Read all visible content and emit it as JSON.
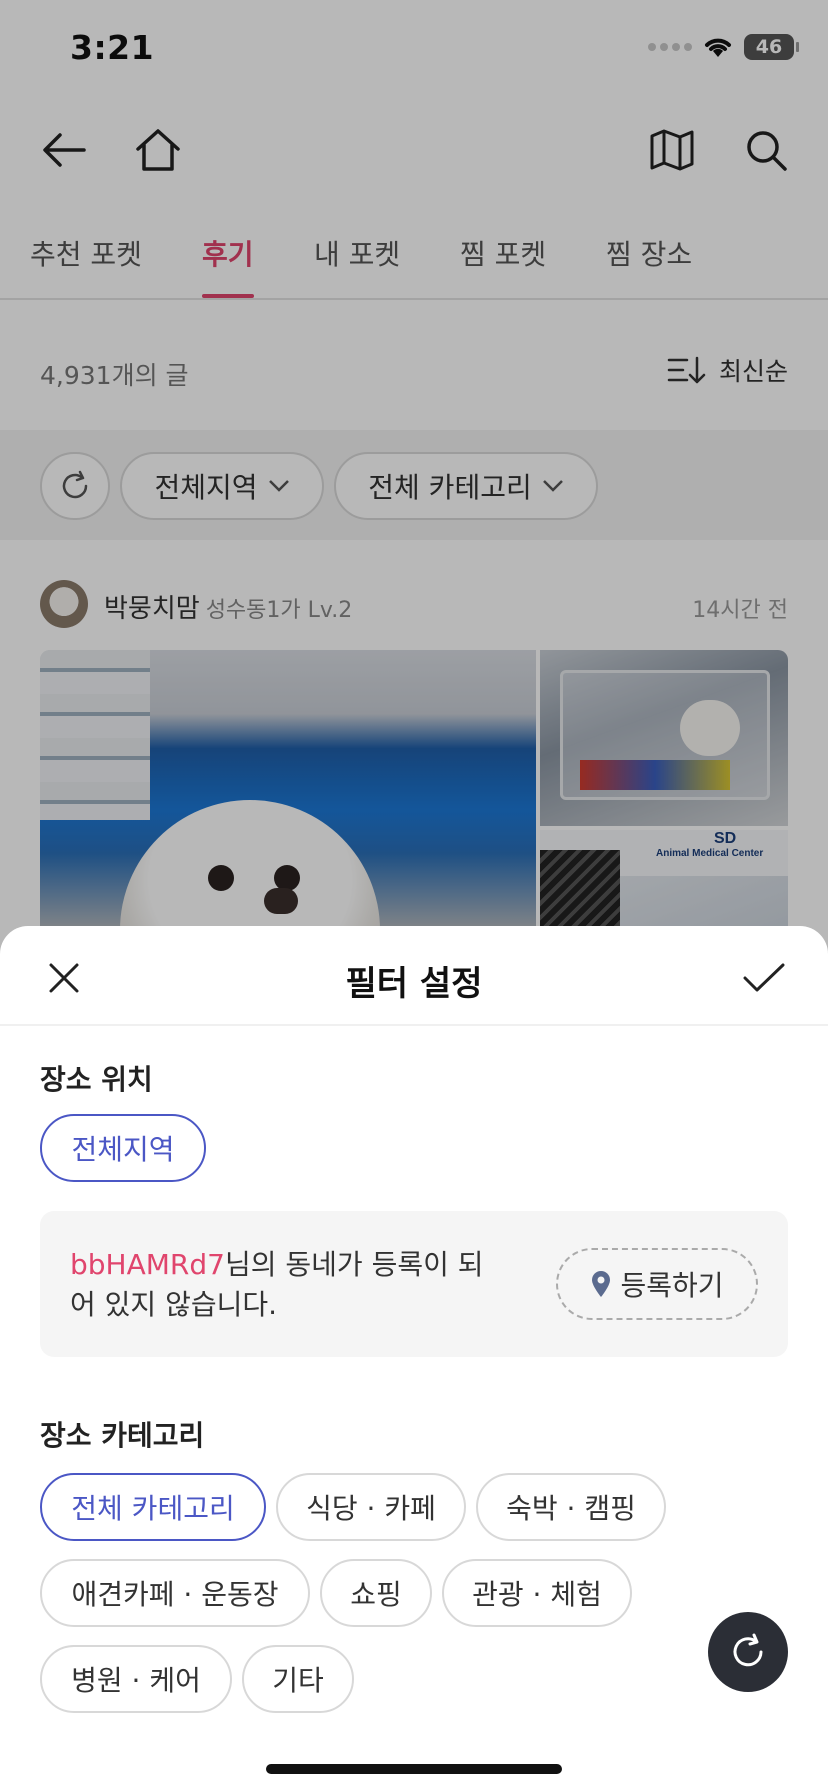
{
  "status_bar": {
    "time": "3:21",
    "battery": "46"
  },
  "nav": {
    "back_icon": "arrow-left-icon",
    "home_icon": "home-icon",
    "map_icon": "map-icon",
    "search_icon": "search-icon"
  },
  "tabs": [
    {
      "label": "추천 포켓",
      "active": false
    },
    {
      "label": "후기",
      "active": true
    },
    {
      "label": "내 포켓",
      "active": false
    },
    {
      "label": "찜 포켓",
      "active": false
    },
    {
      "label": "찜 장소",
      "active": false
    }
  ],
  "feed": {
    "post_count": "4,931개의 글",
    "sort_label": "최신순",
    "filter_chips": {
      "region": "전체지역",
      "category": "전체 카테고리"
    },
    "post": {
      "author": "박뭉치맘",
      "author_meta": "성수동1가 Lv.2",
      "time": "14시간 전",
      "photo_sign_text": "Animal Medical Center",
      "photo_sign_logo": "SD"
    }
  },
  "sheet": {
    "title": "필터 설정",
    "location_section": {
      "title": "장소 위치",
      "selected_chip": "전체지역"
    },
    "notice": {
      "username": "bbHAMRd7",
      "message": "님의 동네가 등록이 되어 있지 않습니다.",
      "register_label": "등록하기"
    },
    "category_section": {
      "title": "장소 카테고리",
      "chips": [
        {
          "label": "전체 카테고리",
          "selected": true
        },
        {
          "label": "식당 · 카페",
          "selected": false
        },
        {
          "label": "숙박 · 캠핑",
          "selected": false
        },
        {
          "label": "애견카페 · 운동장",
          "selected": false
        },
        {
          "label": "쇼핑",
          "selected": false
        },
        {
          "label": "관광 · 체험",
          "selected": false
        },
        {
          "label": "병원 · 케어",
          "selected": false
        },
        {
          "label": "기타",
          "selected": false
        }
      ]
    }
  },
  "colors": {
    "accent_pink": "#e0456d",
    "selected_blue": "#4b57c5",
    "fab_dark": "#2b2e36"
  }
}
